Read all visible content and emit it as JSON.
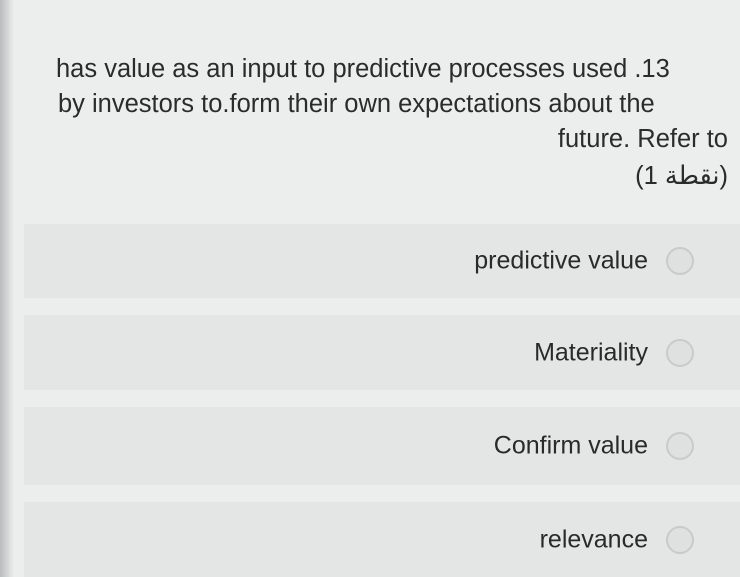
{
  "question": {
    "line1": "has value as an input to predictive processes used .13",
    "line2": "by investors to.form their own expectations about the",
    "line3": "future. Refer to",
    "line4": "(نقطة 1)"
  },
  "options": [
    {
      "label": "predictive value"
    },
    {
      "label": "Materiality"
    },
    {
      "label": "Confirm value"
    },
    {
      "label": "relevance"
    }
  ]
}
